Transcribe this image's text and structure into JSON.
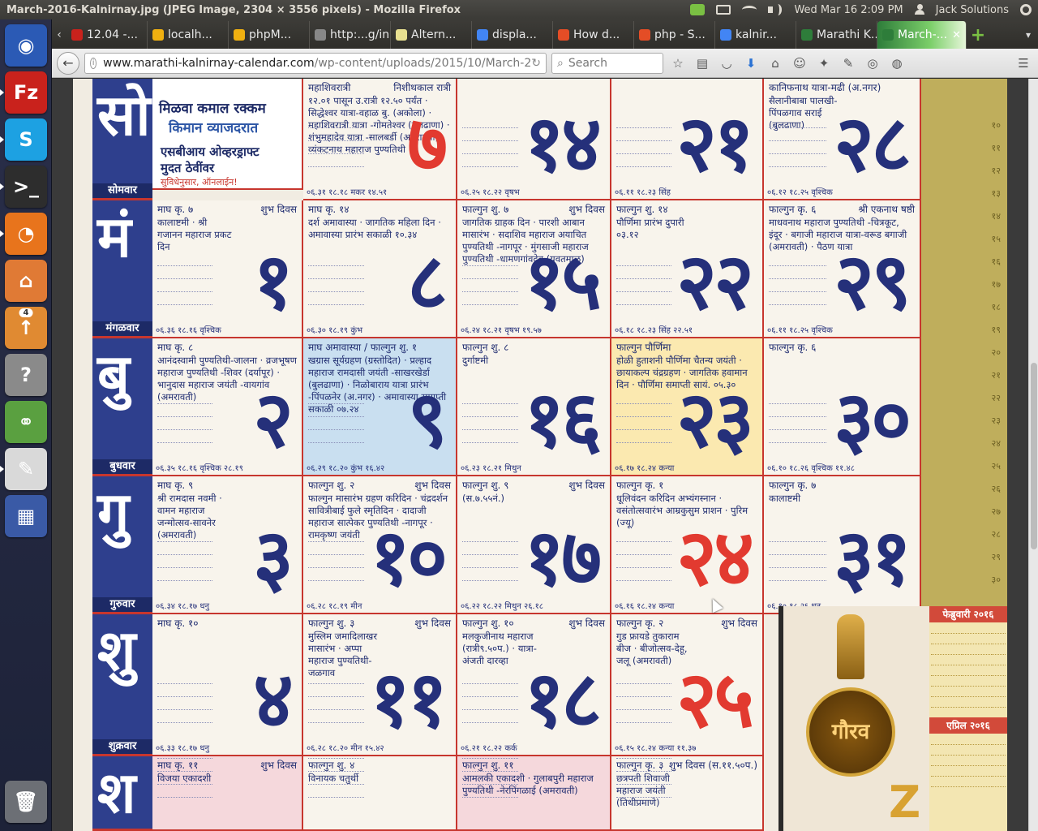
{
  "window": {
    "title": "March-2016-Kalnirnay.jpg (JPEG Image, 2304 × 3556 pixels) - Mozilla Firefox"
  },
  "panel": {
    "clock": "Wed Mar 16  2:09 PM",
    "user": "Jack Solutions"
  },
  "launcher": {
    "items": [
      {
        "name": "ubuntu-dash-icon",
        "glyph": "◉",
        "color": "#2b5ab5"
      },
      {
        "name": "filezilla-icon",
        "glyph": "Fz",
        "color": "#c9221c"
      },
      {
        "name": "skype-icon",
        "glyph": "S",
        "color": "#1da1e2"
      },
      {
        "name": "terminal-icon",
        "glyph": ">_",
        "color": "#2d2d2d"
      },
      {
        "name": "firefox-icon",
        "glyph": "◔",
        "color": "#e8741c"
      },
      {
        "name": "files-icon",
        "glyph": "⌂",
        "color": "#e07a35"
      },
      {
        "name": "software-updater-icon",
        "glyph": "↑",
        "color": "#e08a32",
        "badge": "4"
      },
      {
        "name": "help-icon",
        "glyph": "?",
        "color": "#8a8a8a"
      },
      {
        "name": "connect-icon",
        "glyph": "⚭",
        "color": "#5aa040"
      },
      {
        "name": "text-editor-icon",
        "glyph": "✎",
        "color": "#d9d9d9"
      },
      {
        "name": "workspace-switcher-icon",
        "glyph": "▦",
        "color": "#3a5aa6"
      },
      {
        "name": "trash-icon",
        "glyph": "🗑",
        "color": "#6c6f75"
      }
    ]
  },
  "tabs": [
    {
      "label": "12.04 -...",
      "fav": "#c9221c"
    },
    {
      "label": "localh...",
      "fav": "#f0b010"
    },
    {
      "label": "phpM...",
      "fav": "#f0b010"
    },
    {
      "label": "http:...g/in",
      "fav": "#888888"
    },
    {
      "label": "Altern...",
      "fav": "#e8e090"
    },
    {
      "label": "displa...",
      "fav": "#4285f4"
    },
    {
      "label": "How d...",
      "fav": "#e44d26"
    },
    {
      "label": "php - S...",
      "fav": "#e44d26"
    },
    {
      "label": "kalnir...",
      "fav": "#4285f4"
    },
    {
      "label": "Marathi K...",
      "fav": "#2e7d3a"
    },
    {
      "label": "March-...",
      "fav": "#2e7d3a",
      "active": true
    }
  ],
  "nav": {
    "url_host": "www.marathi-kalnirnay-calendar.com",
    "url_path": "/wp-content/uploads/2015/10/March-2",
    "search_placeholder": "Search"
  },
  "calendar": {
    "weekdays": [
      {
        "big": "सो",
        "name": "सोमवार"
      },
      {
        "big": "मं",
        "name": "मंगळवार"
      },
      {
        "big": "बु",
        "name": "बुधवार"
      },
      {
        "big": "गु",
        "name": "गुरुवार"
      },
      {
        "big": "शु",
        "name": "शुक्रवार"
      },
      {
        "big": "श",
        "name": ""
      }
    ],
    "ad": {
      "line1": "मिळवा कमाल रक्कम",
      "line2": "किमान व्याजदरात",
      "line3": "एसबीआय ओव्हरड्राफ्ट",
      "line4": "मुदत ठेवींवर",
      "line5": "सुविधेनुसार, ऑनलाईन!"
    },
    "rows": [
      [
        {
          "head": "महाशिवरात्री",
          "tag": "निशीथकाल रात्री",
          "notes": "१२.०१ पासून उ.रात्री १२.५० पर्यंत · सिद्धेश्वर यात्रा-वहाळ बु. (अकोला) · महाशिवरात्री यात्रा -गोमतेश्वर (बुलढाणा) · शंभुमहादेव यात्रा -सालबर्डी (अमरावती) · व्यंकटनाथ महाराज पुण्यतिथी",
          "num": "७",
          "red": true,
          "foot": "०६.३१ १८.१८ मकर १४.५१"
        },
        {
          "head": "",
          "tag": "",
          "notes": "",
          "num": "१४",
          "foot": "०६.२५ १८.२२ वृषभ"
        },
        {
          "head": "",
          "tag": "",
          "notes": "",
          "num": "२१",
          "foot": "०६.११ १८.२३ सिंह"
        },
        {
          "head": "कानिफनाथ यात्रा-मढी (अ.नगर)",
          "tag": "",
          "notes": "सैलानीबाबा पालखी-पिंपळगाव सराई (बुलढाणा)",
          "num": "२८",
          "foot": "०६.१२ १८.२५ वृश्चिक"
        }
      ],
      [
        {
          "head": "माघ कृ. ७",
          "tag": "शुभ दिवस",
          "notes": "कालाष्टमी · श्री गजानन महाराज प्रकट दिन",
          "num": "१",
          "foot": "०६.३६ १८.१६ वृश्चिक"
        },
        {
          "head": "माघ कृ. १४",
          "tag": "",
          "notes": "दर्श अमावास्या · जागतिक महिला दिन · अमावास्या प्रारंभ सकाळी १०.३४",
          "num": "८",
          "foot": "०६.३० १८.१९ कुंभ"
        },
        {
          "head": "फाल्गुन शु. ७",
          "tag": "शुभ दिवस",
          "notes": "जागतिक ग्राहक दिन · पारशी आबान मासारंभ · सदाशिव महाराज अयाचित पुण्यतिथी -नागपूर · मुंगसाजी महाराज पुण्यतिथी -धामणगांवदेव (यवतमाळ)",
          "num": "१५",
          "foot": "०६.२४ १८.२१ वृषभ १९.५७"
        },
        {
          "head": "फाल्गुन शु. १४",
          "tag": "",
          "notes": "पौर्णिमा प्रारंभ दुपारी ०३.१२",
          "num": "२२",
          "foot": "०६.१८ १८.२३ सिंह २२.५१"
        },
        {
          "head": "फाल्गुन कृ. ६",
          "tag": "श्री एकनाथ षष्ठी",
          "notes": "माधवनाथ महाराज पुण्यतिथी -चित्रकूट, इंदूर · बगाजी महाराज यात्रा-वरूड बगाजी (अमरावती) · पैठण यात्रा",
          "num": "२९",
          "foot": "०६.११ १८.२५ वृश्चिक"
        }
      ],
      [
        {
          "head": "माघ कृ. ८",
          "tag": "",
          "notes": "आनंदस्वामी पुण्यतिथी-जालना · व्रजभूषण महाराज पुण्यतिथी -शिवर (दर्यापूर) · भानुदास महाराज जयंती -वायगांव (अमरावती)",
          "num": "२",
          "foot": "०६.३५ १८.१६ वृश्चिक २८.१९"
        },
        {
          "head": "माघ अमावास्या / फाल्गुन शु. १",
          "tag": "",
          "notes": "खग्रास सूर्यग्रहण (ग्रस्तोदित) · प्रल्हाद महाराज रामदासी जयंती -साखरखेर्डा (बुलढाणा) · निळोबाराय यात्रा प्रारंभ -पिंपळनेर (अ.नगर) · अमावास्या समाप्ती सकाळी ०७.२४",
          "num": "९",
          "tint": "blue",
          "foot": "०६.२९ १८.२० कुंभ १६.४२"
        },
        {
          "head": "फाल्गुन शु. ८",
          "tag": "",
          "notes": "दुर्गाष्टमी",
          "num": "१६",
          "foot": "०६.२३ १८.२१ मिथुन"
        },
        {
          "head": "फाल्गुन पौर्णिमा",
          "tag": "",
          "notes": "होळी हुताशनी पौर्णिमा चैतन्य जयंती · छायाकल्प चंद्रग्रहण · जागतिक हवामान दिन · पौर्णिमा समाप्ती सायं. ०५.३०",
          "num": "२३",
          "tint": "yellow",
          "foot": "०६.१७ १८.२४ कन्या"
        },
        {
          "head": "फाल्गुन कृ. ६",
          "tag": "",
          "notes": "",
          "num": "३०",
          "foot": "०६.१० १८.२६ वृश्चिक ११.४८"
        }
      ],
      [
        {
          "head": "माघ कृ. ९",
          "tag": "",
          "notes": "श्री रामदास नवमी · वामन महाराज जन्मोत्सव-सावनेर (अमरावती)",
          "num": "३",
          "foot": "०६.३४ १८.१७ धनु"
        },
        {
          "head": "फाल्गुन शु. २",
          "tag": "शुभ दिवस",
          "notes": "फाल्गुन मासारंभ ग्रहण करिदिन · चंद्रदर्शन सावित्रीबाई फुले स्मृतिदिन · दादाजी महाराज सात्पेकर पुण्यतिथी -नागपूर · रामकृष्ण जयंती",
          "num": "१०",
          "foot": "०६.२८ १८.१९ मीन"
        },
        {
          "head": "फाल्गुन शु. ९",
          "tag": "शुभ दिवस",
          "notes": "(स.७.५५नं.)",
          "num": "१७",
          "foot": "०६.२२ १८.२२ मिथुन २६.१८"
        },
        {
          "head": "फाल्गुन कृ. १",
          "tag": "",
          "notes": "धूलिवंदन करिदिन अभ्यंगस्नान · वसंतोत्सवारंभ आम्रकुसुम प्राशन · पुरिम (ज्यू)",
          "num": "२४",
          "red": true,
          "foot": "०६.१६ १८.२४ कन्या"
        },
        {
          "head": "फाल्गुन कृ. ७",
          "tag": "",
          "notes": "कालाष्टमी",
          "num": "३१",
          "foot": "०६.१० १८.२६ धनु"
        }
      ],
      [
        {
          "head": "माघ कृ. १०",
          "tag": "",
          "notes": "",
          "num": "४",
          "foot": "०६.३३ १८.१७ धनु"
        },
        {
          "head": "फाल्गुन शु. ३",
          "tag": "शुभ दिवस",
          "notes": "मुस्लिम जमादिलाखर मासारंभ · अप्पा महाराज पुण्यतिथी-जळगाव",
          "num": "११",
          "foot": "०६.२८ १८.२० मीन १५.४२"
        },
        {
          "head": "फाल्गुन शु. १०",
          "tag": "शुभ दिवस",
          "notes": "मलकुजीनाथ महाराज (रात्री९.५०प.) · यात्रा-अंजती दारव्हा",
          "num": "१८",
          "foot": "०६.२१ १८.२२ कर्क"
        },
        {
          "head": "फाल्गुन कृ. २",
          "tag": "शुभ दिवस",
          "notes": "गुड फ्रायडे तुकाराम बीज · बीजोत्सव-देहू, जलू (अमरावती)",
          "num": "२५",
          "red": true,
          "foot": "०६.१५ १८.२४ कन्या ११.३७"
        }
      ],
      [
        {
          "head": "माघ कृ. ११",
          "tag": "शुभ दिवस",
          "notes": "विजया एकादशी",
          "num": "",
          "tint": "pink",
          "foot": ""
        },
        {
          "head": "फाल्गुन शु. ४",
          "tag": "",
          "notes": "विनायक चतुर्थी",
          "num": "",
          "foot": ""
        },
        {
          "head": "फाल्गुन शु. ११",
          "tag": "",
          "notes": "आमलकी एकादशी · गुलाबपुरी महाराज पुण्यतिथी -नेरपिंगळाई (अमरावती)",
          "num": "",
          "tint": "pink",
          "foot": ""
        },
        {
          "head": "फाल्गुन कृ. ३",
          "tag": "शुभ दिवस (स.११.५०प.)",
          "notes": "छत्रपती शिवाजी महाराज जयंती (तिथीप्रमाणे)",
          "num": "",
          "foot": ""
        }
      ]
    ],
    "strip_numbers": [
      "१०",
      "११",
      "१२",
      "१३",
      "१४",
      "१५",
      "१६",
      "१७",
      "१८",
      "१९",
      "२०",
      "२१",
      "२२",
      "२३",
      "२४",
      "२५",
      "२६",
      "२७",
      "२८",
      "२९",
      "३०"
    ],
    "promo": {
      "seal_text": "गौरव",
      "brand": "Z"
    },
    "mini": [
      {
        "title": "फेब्रुवारी २०१६"
      },
      {
        "title": "एप्रिल २०१६"
      }
    ]
  }
}
